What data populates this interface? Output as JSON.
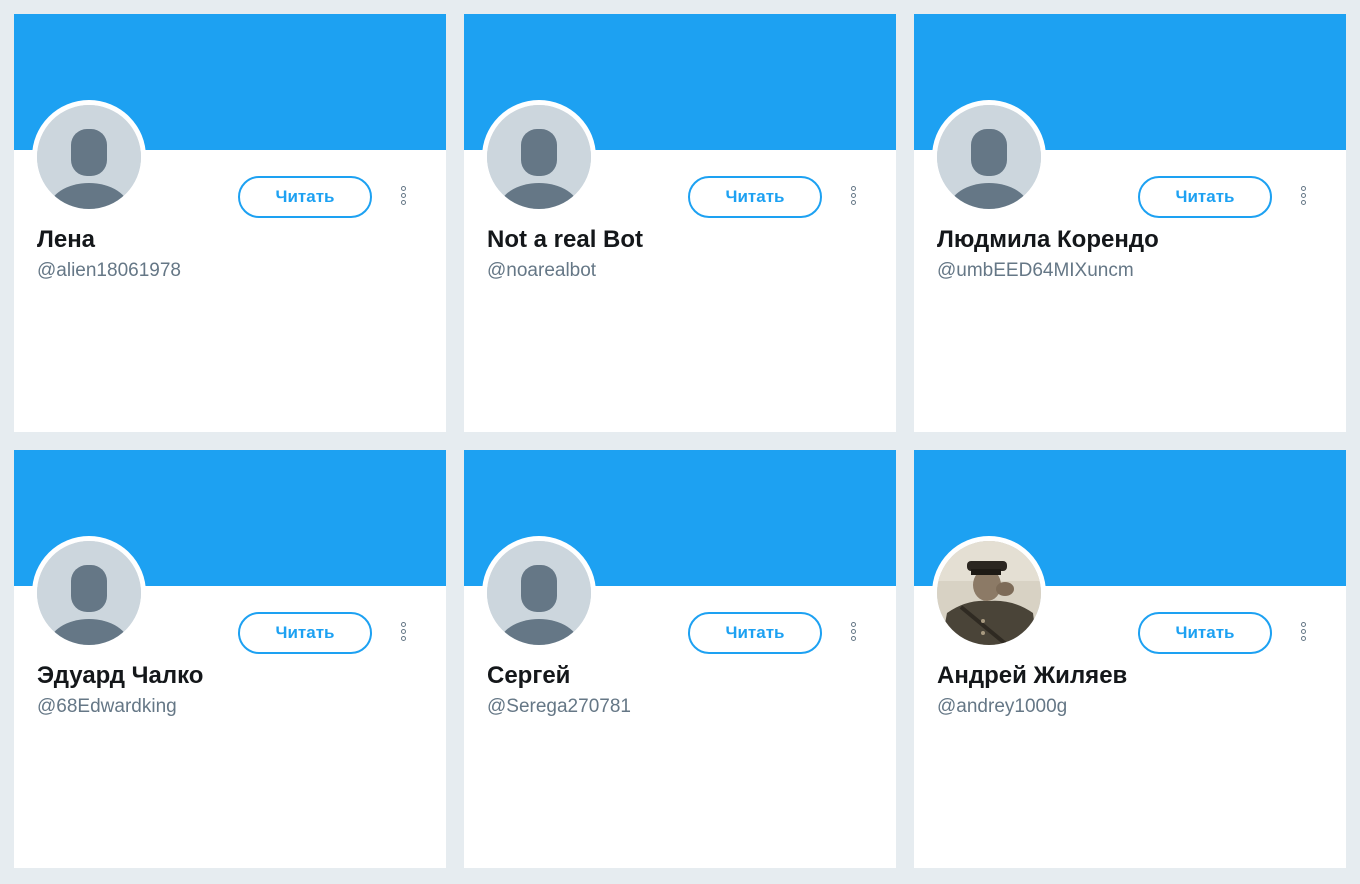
{
  "follow_label": "Читать",
  "colors": {
    "banner": "#1da1f2",
    "accent": "#1da1f2",
    "name": "#14171a",
    "handle": "#657786",
    "background": "#e6ecf0",
    "default_avatar_bg": "#ccd6dd",
    "default_avatar_fg": "#657786"
  },
  "cards": [
    {
      "name": "Лена",
      "handle": "@alien18061978",
      "avatar": "default-avatar-icon"
    },
    {
      "name": "Not a real Bot",
      "handle": "@noarealbot",
      "avatar": "default-avatar-icon"
    },
    {
      "name": "Людмила Корендо",
      "handle": "@umbEED64MIXuncm",
      "avatar": "default-avatar-icon"
    },
    {
      "name": "Эдуард Чалко",
      "handle": "@68Edwardking",
      "avatar": "default-avatar-icon"
    },
    {
      "name": "Сергей",
      "handle": "@Serega270781",
      "avatar": "default-avatar-icon"
    },
    {
      "name": "Андрей Жиляев",
      "handle": "@andrey1000g",
      "avatar": "photo-avatar"
    }
  ]
}
